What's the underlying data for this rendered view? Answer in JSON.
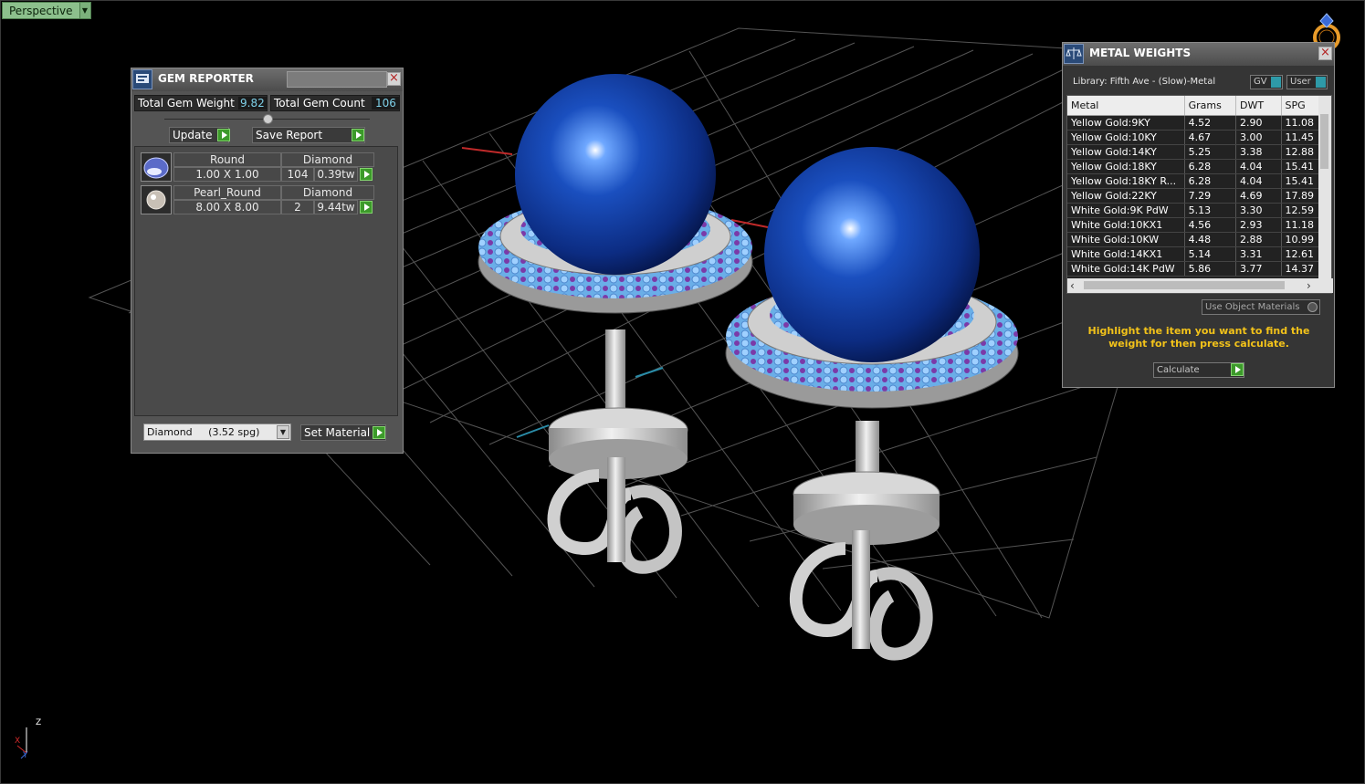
{
  "viewport": {
    "label": "Perspective"
  },
  "axis": {
    "z": "Z",
    "x": "X",
    "y": "Y"
  },
  "gem_reporter": {
    "title": "GEM REPORTER",
    "total_weight_label": "Total Gem Weight",
    "total_weight_value": "9.82",
    "total_count_label": "Total Gem Count",
    "total_count_value": "106",
    "update_label": "Update",
    "save_report_label": "Save Report",
    "rows": [
      {
        "shape": "Round",
        "material": "Diamond",
        "size": "1.00 X 1.00",
        "count": "104",
        "weight": "0.39tw"
      },
      {
        "shape": "Pearl_Round",
        "material": "Diamond",
        "size": "8.00 X 8.00",
        "count": "2",
        "weight": "9.44tw"
      }
    ],
    "material_select": "Diamond     (3.52 spg)",
    "set_material_label": "Set Material"
  },
  "metal_weights": {
    "title": "METAL WEIGHTS",
    "library": "Library: Fifth Ave - (Slow)-Metal",
    "gv_label": "GV",
    "user_label": "User",
    "columns": [
      "Metal",
      "Grams",
      "DWT",
      "SPG"
    ],
    "rows": [
      [
        "Yellow Gold:9KY",
        "4.52",
        "2.90",
        "11.08"
      ],
      [
        "Yellow Gold:10KY",
        "4.67",
        "3.00",
        "11.45"
      ],
      [
        "Yellow Gold:14KY",
        "5.25",
        "3.38",
        "12.88"
      ],
      [
        "Yellow Gold:18KY",
        "6.28",
        "4.04",
        "15.41"
      ],
      [
        "Yellow Gold:18KY R...",
        "6.28",
        "4.04",
        "15.41"
      ],
      [
        "Yellow Gold:22KY",
        "7.29",
        "4.69",
        "17.89"
      ],
      [
        "White Gold:9K PdW",
        "5.13",
        "3.30",
        "12.59"
      ],
      [
        "White Gold:10KX1",
        "4.56",
        "2.93",
        "11.18"
      ],
      [
        "White Gold:10KW",
        "4.48",
        "2.88",
        "10.99"
      ],
      [
        "White Gold:14KX1",
        "5.14",
        "3.31",
        "12.61"
      ],
      [
        "White Gold:14K PdW",
        "5.86",
        "3.77",
        "14.37"
      ]
    ],
    "use_object_materials": "Use Object Materials",
    "instruction": "Highlight the item you want to find the weight for then press calculate.",
    "calculate_label": "Calculate"
  },
  "colors": {
    "accent_green": "#3c9a2a",
    "instruction_yellow": "#f2c21a",
    "value_cyan": "#7ed0e8"
  }
}
